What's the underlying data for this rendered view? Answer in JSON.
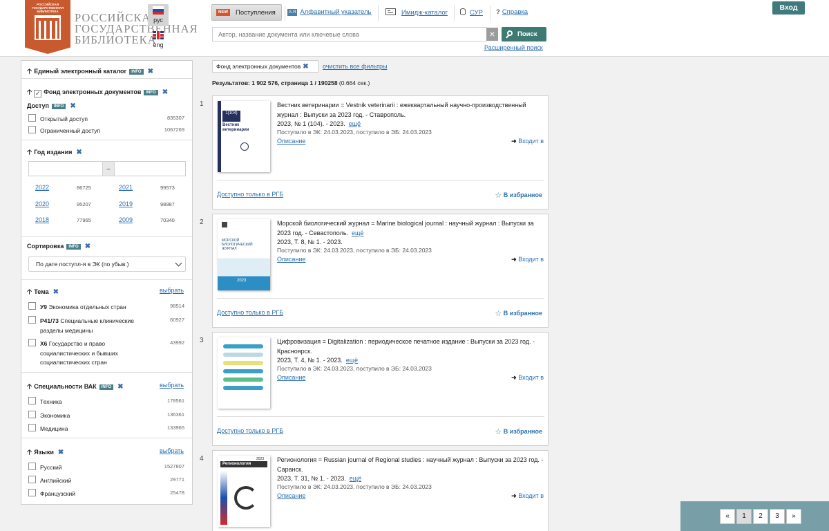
{
  "header": {
    "logo_small": "РОССИЙСКАЯ ГОСУДАРСТВЕННАЯ БИБЛИОТЕКА",
    "logo_line1": "РОССИЙСКАЯ",
    "logo_line2": "ГОСУДАРСТВЕННАЯ",
    "logo_line3": "БИБЛИОТЕКА",
    "lang_ru": "рус",
    "lang_en": "eng",
    "nav_new_badge": "NEW",
    "nav_new_label": "Поступления",
    "nav_alpha_icon": "А-Я",
    "nav_alpha_label": "Алфавитный указатель",
    "nav_image_label": "Имидж-каталог",
    "nav_sur_label": "СУР",
    "nav_help_label": "Справка",
    "search_placeholder": "Автор, название документа или ключевые слова",
    "search_button": "Поиск",
    "advanced_search": "Расширенный поиск",
    "login": "Вход"
  },
  "sidebar": {
    "unified_catalog": "Единый электронный каталог",
    "info": "INFO",
    "fund": "Фонд электронных документов",
    "access": {
      "title": "Доступ",
      "items": [
        {
          "label": "Открытый доступ",
          "count": "835307"
        },
        {
          "label": "Ограниченный доступ",
          "count": "1067269"
        }
      ]
    },
    "year": {
      "title": "Год издания",
      "dash": "–",
      "items": [
        {
          "year": "2022",
          "count": "86725"
        },
        {
          "year": "2021",
          "count": "99573"
        },
        {
          "year": "2020",
          "count": "95207"
        },
        {
          "year": "2019",
          "count": "98987"
        },
        {
          "year": "2018",
          "count": "77965"
        },
        {
          "year": "2009",
          "count": "70340"
        }
      ]
    },
    "sort": {
      "title": "Сортировка",
      "selected": "По дате поступл-я в ЭК (по убыв.)"
    },
    "theme": {
      "title": "Тема",
      "pick": "выбрать",
      "items": [
        {
          "code": "У9",
          "label": "Экономика отдельных стран",
          "count": "98514"
        },
        {
          "code": "Р41/73",
          "label": "Специальные клинические разделы медицины",
          "count": "60927"
        },
        {
          "code": "Х6",
          "label": "Государство и право социалистических и бывших социалистических стран",
          "count": "43992"
        }
      ]
    },
    "vak": {
      "title": "Специальности ВАК",
      "pick": "выбрать",
      "items": [
        {
          "label": "Техника",
          "count": "178561"
        },
        {
          "label": "Экономика",
          "count": "136361"
        },
        {
          "label": "Медицина",
          "count": "133965"
        }
      ]
    },
    "langs": {
      "title": "Языки",
      "pick": "выбрать",
      "items": [
        {
          "label": "Русский",
          "count": "1527807"
        },
        {
          "label": "Английский",
          "count": "29771"
        },
        {
          "label": "Французский",
          "count": "25478"
        }
      ]
    }
  },
  "main": {
    "filter_chip": "Фонд электронных документов",
    "clear_filters": "очистить все фильтры",
    "results_text": "Результатов: 1 902 576, страница 1 / 190258",
    "results_time": "(0.664 сек.)",
    "more": "ещё",
    "description": "Описание",
    "entry": "Входит в",
    "avail": "Доступно только в РГБ",
    "fav": "В избранное",
    "cards": [
      {
        "num": "1",
        "title": "Вестник ветеринарии = Vestnik veterinarii : ежеквартальный научно-производственный журнал : Выпуски за 2023 год. - Ставрополь.",
        "issue": "2023, № 1 (104). - 2023.",
        "received": "Поступило в ЭК: 24.03.2023, поступило в ЭБ: 24.03.2023",
        "cover_text": "Вестник ветеринарии",
        "cover_num": "1(104)"
      },
      {
        "num": "2",
        "title": "Морской биологический журнал = Marine biological journal : научный журнал : Выпуски за 2023 год. - Севастополь.",
        "issue": "2023, Т. 8, № 1. - 2023.",
        "received": "Поступило в ЭК: 24.03.2023, поступило в ЭБ: 24.03.2023",
        "cover_text": "МОРСКОЙ БИОЛОГИЧЕСКИЙ ЖУРНАЛ",
        "cover_num": "2023"
      },
      {
        "num": "3",
        "title": "Цифровизация = Digitalization : периодическое печатное издание : Выпуски за 2023 год. - Красноярск.",
        "issue": "2023, Т. 4, № 1. - 2023.",
        "received": "Поступило в ЭК: 24.03.2023, поступило в ЭБ: 24.03.2023",
        "cover_text": "",
        "cover_num": ""
      },
      {
        "num": "4",
        "title": "Регионология = Russian journal of Regional studies : научный журнал : Выпуски за 2023 год. - Саранск.",
        "issue": "2023, Т. 31, № 1. - 2023.",
        "received": "Поступило в ЭК: 24.03.2023, поступило в ЭБ: 24.03.2023",
        "cover_text": "Регионология",
        "cover_num": "2023"
      }
    ]
  },
  "pager": {
    "prev": "«",
    "pages": [
      "1",
      "2",
      "3"
    ],
    "next": "»"
  },
  "colors": {
    "accent": "#3d7b72",
    "link": "#2a6fad",
    "logo": "#c9592e",
    "pager_bg": "#789fa7"
  }
}
